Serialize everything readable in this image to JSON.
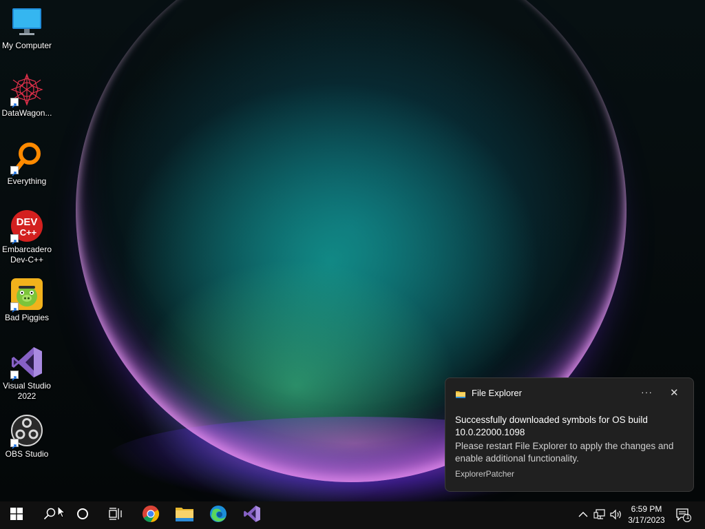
{
  "desktop": {
    "icons": [
      {
        "label": "My Computer",
        "icon": "monitor-icon"
      },
      {
        "label": "DataWagon...",
        "icon": "datawagon-icon"
      },
      {
        "label": "Everything",
        "icon": "everything-search-icon"
      },
      {
        "label": "Embarcadero Dev-C++",
        "icon": "devcpp-icon",
        "line1": "Embarcadero",
        "line2": "Dev-C++"
      },
      {
        "label": "Bad Piggies",
        "icon": "bad-piggies-icon"
      },
      {
        "label": "Visual Studio 2022",
        "icon": "visual-studio-icon",
        "line1": "Visual Studio",
        "line2": "2022"
      },
      {
        "label": "OBS Studio",
        "icon": "obs-icon"
      }
    ]
  },
  "toast": {
    "app_name": "File Explorer",
    "more_label": "···",
    "close_label": "✕",
    "title": "Successfully downloaded symbols for OS build 10.0.22000.1098",
    "body": "Please restart File Explorer to apply the changes and enable additional functionality.",
    "attribution": "ExplorerPatcher"
  },
  "taskbar": {
    "buttons": [
      "start-icon",
      "search-icon",
      "cortana-icon",
      "task-view-icon",
      "chrome-icon",
      "file-explorer-icon",
      "edge-icon",
      "visual-studio-icon"
    ],
    "tray": {
      "time": "6:59 PM",
      "date": "3/17/2023",
      "notification_count": "1"
    }
  },
  "colors": {
    "taskbar": "#101010",
    "toast_bg": "#202020",
    "chrome_red": "#db4437",
    "chrome_green": "#0f9d58",
    "chrome_yellow": "#f4b400",
    "chrome_blue": "#4285f4",
    "vs_purple": "#8661c5"
  }
}
